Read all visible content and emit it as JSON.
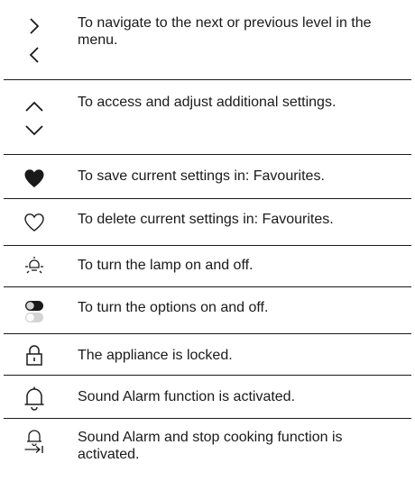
{
  "rows": [
    {
      "icons": [
        "chevron-right-icon",
        "chevron-left-icon"
      ],
      "text": "To navigate to the next or previous level in the menu."
    },
    {
      "icons": [
        "chevron-up-icon",
        "chevron-down-icon"
      ],
      "text": "To access and adjust additional settings."
    },
    {
      "icons": [
        "heart-filled-icon"
      ],
      "text": "To save current settings in: Favourites."
    },
    {
      "icons": [
        "heart-outline-icon"
      ],
      "text": "To delete current settings in: Favourites."
    },
    {
      "icons": [
        "lamp-icon"
      ],
      "text": "To turn the lamp on and off."
    },
    {
      "icons": [
        "toggle-switch-icon"
      ],
      "text": "To turn the options on and off."
    },
    {
      "icons": [
        "padlock-icon"
      ],
      "text": "The appliance is locked."
    },
    {
      "icons": [
        "bell-icon"
      ],
      "text": "Sound Alarm function is activated."
    },
    {
      "icons": [
        "bell-stop-icon"
      ],
      "text": "Sound Alarm and stop cooking function is activated."
    }
  ],
  "colors": {
    "ink": "#1a1a1a",
    "toggle_light": "#d4d4d4"
  }
}
